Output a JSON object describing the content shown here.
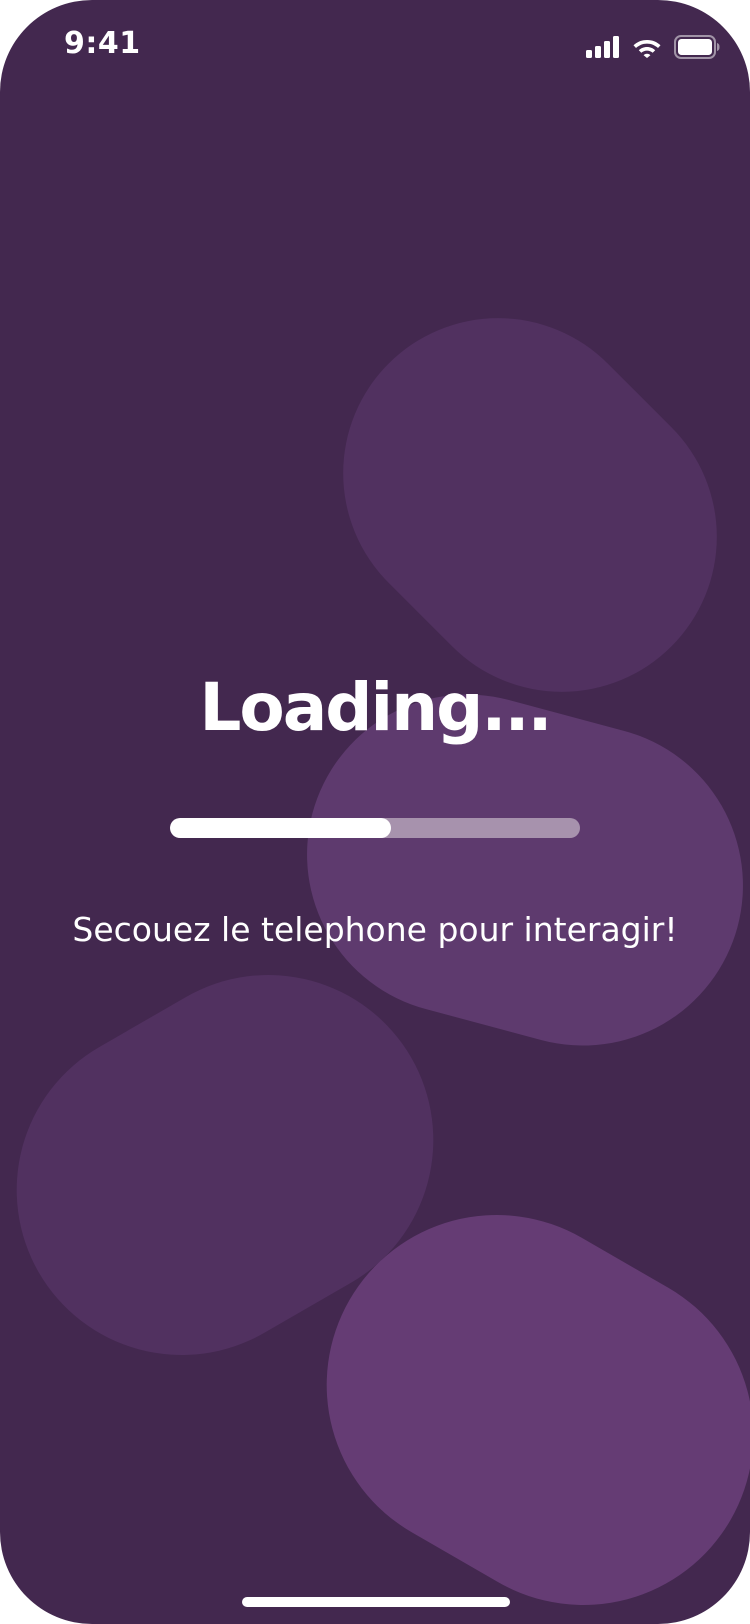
{
  "status_bar": {
    "time": "9:41",
    "signal_icon": "cellular-signal-icon",
    "wifi_icon": "wifi-icon",
    "battery_icon": "battery-icon"
  },
  "main": {
    "title": "Loading...",
    "progress": 0.54,
    "hint": "Secouez le telephone pour interagir!"
  },
  "colors": {
    "background": "#43284f",
    "blob_dark": "#513160",
    "blob_light": "#5e3a6e",
    "blob_lighter": "#653c74",
    "text": "#ffffff",
    "progress_fill": "#ffffff",
    "progress_track": "#a792ad"
  }
}
